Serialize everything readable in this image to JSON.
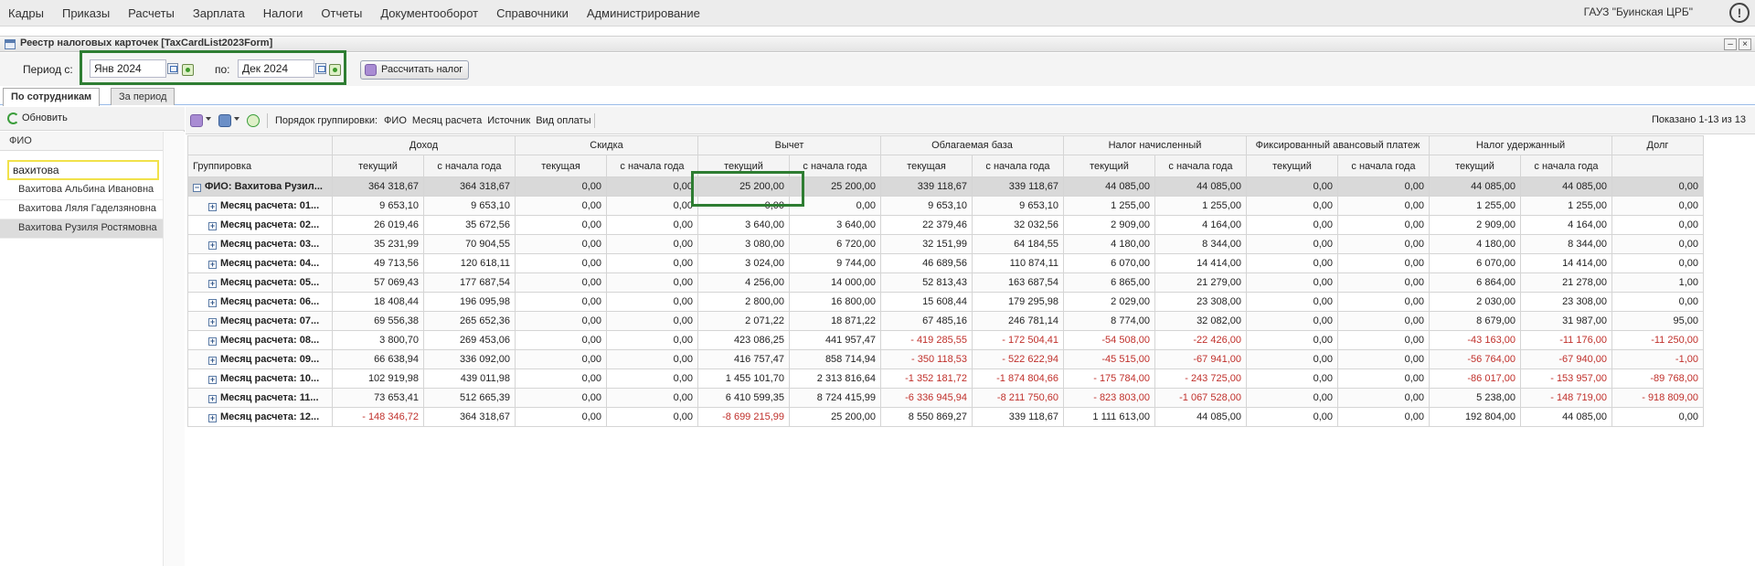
{
  "menu": [
    "Кадры",
    "Приказы",
    "Расчеты",
    "Зарплата",
    "Налоги",
    "Отчеты",
    "Документооборот",
    "Справочники",
    "Администрирование"
  ],
  "org_name": "ГАУЗ \"Буинская ЦРБ\"",
  "alert_symbol": "!",
  "window": {
    "title": "Реестр налоговых карточек [TaxCardList2023Form]",
    "minimize": "–",
    "close": "×"
  },
  "period": {
    "from_label": "Период с:",
    "from_value": "Янв 2024",
    "to_label": "по:",
    "to_value": "Дек 2024",
    "calc_button": "Рассчитать налог"
  },
  "tabs": [
    "По сотрудникам",
    "За период"
  ],
  "left": {
    "refresh": "Обновить",
    "column_header": "ФИО",
    "search_value": "вахитова",
    "employees": [
      "Вахитова Альбина Ивановна",
      "Вахитова Ляля Гаделзяновна",
      "Вахитова Рузиля Ростямовна"
    ],
    "selected_index": 2
  },
  "grid_toolbar": {
    "group_label": "Порядок группировки:",
    "group_fields": [
      "ФИО",
      "Месяц расчета",
      "Источник",
      "Вид оплаты"
    ],
    "shown": "Показано 1-13 из 13"
  },
  "grid": {
    "group_header": "Группировка",
    "column_groups": [
      "Доход",
      "Скидка",
      "Вычет",
      "Облагаемая база",
      "Налог начисленный",
      "Фиксированный авансовый платеж",
      "Налог удержанный",
      "Долг"
    ],
    "sub_headers": [
      "текущий",
      "с начала года",
      "текущая",
      "с начала года",
      "текущий",
      "с начала года",
      "текущая",
      "с начала года",
      "текущий",
      "с начала года",
      "текущий",
      "с начала года",
      "текущий",
      "с начала года",
      ""
    ],
    "rows": [
      {
        "label": "ФИО: Вахитова Рузил...",
        "top": true,
        "values": [
          "364 318,67",
          "364 318,67",
          "0,00",
          "0,00",
          "25 200,00",
          "25 200,00",
          "339 118,67",
          "339 118,67",
          "44 085,00",
          "44 085,00",
          "0,00",
          "0,00",
          "44 085,00",
          "44 085,00",
          "0,00"
        ]
      },
      {
        "label": "Месяц расчета: 01...",
        "values": [
          "9 653,10",
          "9 653,10",
          "0,00",
          "0,00",
          "0,00",
          "0,00",
          "9 653,10",
          "9 653,10",
          "1 255,00",
          "1 255,00",
          "0,00",
          "0,00",
          "1 255,00",
          "1 255,00",
          "0,00"
        ]
      },
      {
        "label": "Месяц расчета: 02...",
        "values": [
          "26 019,46",
          "35 672,56",
          "0,00",
          "0,00",
          "3 640,00",
          "3 640,00",
          "22 379,46",
          "32 032,56",
          "2 909,00",
          "4 164,00",
          "0,00",
          "0,00",
          "2 909,00",
          "4 164,00",
          "0,00"
        ]
      },
      {
        "label": "Месяц расчета: 03...",
        "values": [
          "35 231,99",
          "70 904,55",
          "0,00",
          "0,00",
          "3 080,00",
          "6 720,00",
          "32 151,99",
          "64 184,55",
          "4 180,00",
          "8 344,00",
          "0,00",
          "0,00",
          "4 180,00",
          "8 344,00",
          "0,00"
        ]
      },
      {
        "label": "Месяц расчета: 04...",
        "values": [
          "49 713,56",
          "120 618,11",
          "0,00",
          "0,00",
          "3 024,00",
          "9 744,00",
          "46 689,56",
          "110 874,11",
          "6 070,00",
          "14 414,00",
          "0,00",
          "0,00",
          "6 070,00",
          "14 414,00",
          "0,00"
        ]
      },
      {
        "label": "Месяц расчета: 05...",
        "values": [
          "57 069,43",
          "177 687,54",
          "0,00",
          "0,00",
          "4 256,00",
          "14 000,00",
          "52 813,43",
          "163 687,54",
          "6 865,00",
          "21 279,00",
          "0,00",
          "0,00",
          "6 864,00",
          "21 278,00",
          "1,00"
        ]
      },
      {
        "label": "Месяц расчета: 06...",
        "values": [
          "18 408,44",
          "196 095,98",
          "0,00",
          "0,00",
          "2 800,00",
          "16 800,00",
          "15 608,44",
          "179 295,98",
          "2 029,00",
          "23 308,00",
          "0,00",
          "0,00",
          "2 030,00",
          "23 308,00",
          "0,00"
        ]
      },
      {
        "label": "Месяц расчета: 07...",
        "values": [
          "69 556,38",
          "265 652,36",
          "0,00",
          "0,00",
          "2 071,22",
          "18 871,22",
          "67 485,16",
          "246 781,14",
          "8 774,00",
          "32 082,00",
          "0,00",
          "0,00",
          "8 679,00",
          "31 987,00",
          "95,00"
        ]
      },
      {
        "label": "Месяц расчета: 08...",
        "values": [
          "3 800,70",
          "269 453,06",
          "0,00",
          "0,00",
          "423 086,25",
          "441 957,47",
          "- 419 285,55",
          "- 172 504,41",
          "-54 508,00",
          "-22 426,00",
          "0,00",
          "0,00",
          "-43 163,00",
          "-11 176,00",
          "-11 250,00"
        ]
      },
      {
        "label": "Месяц расчета: 09...",
        "values": [
          "66 638,94",
          "336 092,00",
          "0,00",
          "0,00",
          "416 757,47",
          "858 714,94",
          "- 350 118,53",
          "- 522 622,94",
          "-45 515,00",
          "-67 941,00",
          "0,00",
          "0,00",
          "-56 764,00",
          "-67 940,00",
          "-1,00"
        ]
      },
      {
        "label": "Месяц расчета: 10...",
        "values": [
          "102 919,98",
          "439 011,98",
          "0,00",
          "0,00",
          "1 455 101,70",
          "2 313 816,64",
          "-1 352 181,72",
          "-1 874 804,66",
          "- 175 784,00",
          "- 243 725,00",
          "0,00",
          "0,00",
          "-86 017,00",
          "- 153 957,00",
          "-89 768,00"
        ]
      },
      {
        "label": "Месяц расчета: 11...",
        "values": [
          "73 653,41",
          "512 665,39",
          "0,00",
          "0,00",
          "6 410 599,35",
          "8 724 415,99",
          "-6 336 945,94",
          "-8 211 750,60",
          "- 823 803,00",
          "-1 067 528,00",
          "0,00",
          "0,00",
          "5 238,00",
          "- 148 719,00",
          "- 918 809,00"
        ]
      },
      {
        "label": "Месяц расчета: 12...",
        "values": [
          "- 148 346,72",
          "364 318,67",
          "0,00",
          "0,00",
          "-8 699 215,99",
          "25 200,00",
          "8 550 869,27",
          "339 118,67",
          "1 111 613,00",
          "44 085,00",
          "0,00",
          "0,00",
          "192 804,00",
          "44 085,00",
          "0,00"
        ]
      }
    ]
  },
  "colors": {
    "negative": "#c0302b",
    "highlight_green": "#2e7d32",
    "search_border": "#f1e24a"
  }
}
